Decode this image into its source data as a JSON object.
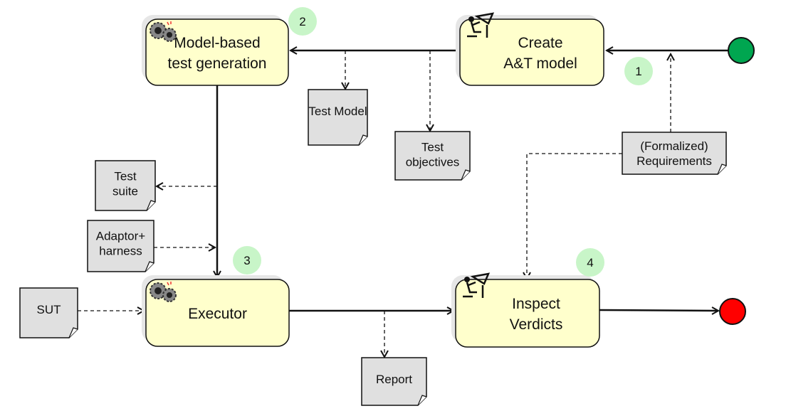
{
  "colors": {
    "process_fill": "#ffffcc",
    "artifact_fill": "#e0e0e0",
    "badge_fill": "#c8f5c8",
    "start": "#00a650",
    "end": "#ff0000"
  },
  "processes": [
    {
      "id": "mbtg",
      "lines": [
        "Model-based",
        "test generation"
      ],
      "badge": "2",
      "icon": "gears-icon"
    },
    {
      "id": "create",
      "lines": [
        "Create",
        "A&T model"
      ],
      "badge": "1",
      "icon": "engineer-at-desk-icon"
    },
    {
      "id": "executor",
      "lines": [
        "Executor"
      ],
      "badge": "3",
      "icon": "gears-icon"
    },
    {
      "id": "inspect",
      "lines": [
        "Inspect",
        "Verdicts"
      ],
      "badge": "4",
      "icon": "engineer-at-desk-icon"
    }
  ],
  "artifacts": {
    "test_model": [
      "Test Model"
    ],
    "test_objectives": [
      "Test",
      "objectives"
    ],
    "test_suite": [
      "Test",
      "suite"
    ],
    "adaptor": [
      "Adaptor+",
      "harness"
    ],
    "sut": [
      "SUT"
    ],
    "report": [
      "Report"
    ],
    "requirements": [
      "(Formalized)",
      "Requirements"
    ]
  }
}
